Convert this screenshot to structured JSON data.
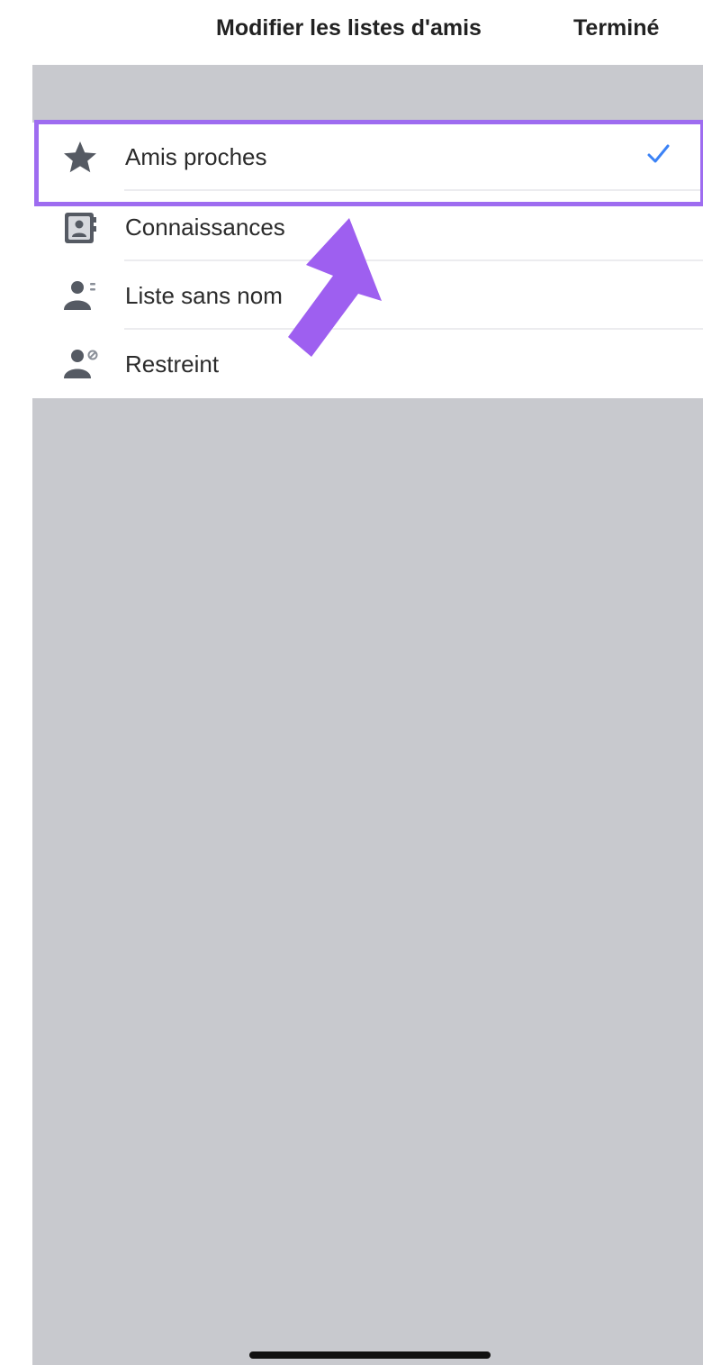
{
  "header": {
    "title": "Modifier les listes d'amis",
    "done_label": "Terminé"
  },
  "friend_lists": [
    {
      "label": "Amis proches",
      "icon": "star-icon",
      "selected": true
    },
    {
      "label": "Connaissances",
      "icon": "contacts-book-icon",
      "selected": false
    },
    {
      "label": "Liste sans nom",
      "icon": "person-list-icon",
      "selected": false
    },
    {
      "label": "Restreint",
      "icon": "person-restricted-icon",
      "selected": false
    }
  ],
  "colors": {
    "highlight": "#9e6cf0",
    "arrow": "#9e5ff0",
    "checkmark": "#3b82f6",
    "panel_background": "#c8c9ce",
    "icon": "#555a63"
  }
}
